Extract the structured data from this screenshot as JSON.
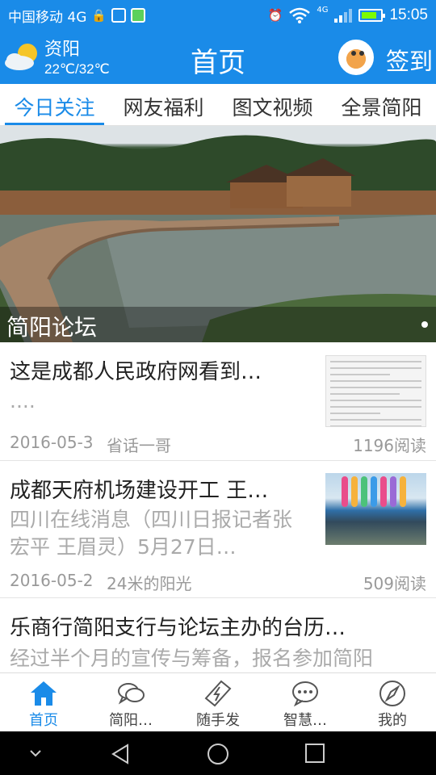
{
  "status_bar": {
    "carrier": "中国移动 4G",
    "network": "4G",
    "time": "15:05"
  },
  "header": {
    "city": "资阳",
    "temperature": "22℃/32℃",
    "title": "首页",
    "checkin_label": "签到",
    "weather_icon": "partly-cloudy-icon"
  },
  "tabs": [
    {
      "label": "今日关注",
      "active": true
    },
    {
      "label": "网友福利",
      "active": false
    },
    {
      "label": "图文视频",
      "active": false
    },
    {
      "label": "全景简阳",
      "active": false
    }
  ],
  "banner": {
    "caption": "简阳论坛"
  },
  "news": [
    {
      "title": "这是成都人民政府网看到…",
      "summary": "....",
      "date": "2016-05-3",
      "author": "省话一哥",
      "reads": "1196阅读"
    },
    {
      "title": "成都天府机场建设开工 王…",
      "summary": "四川在线消息（四川日报记者张宏平 王眉灵）5月27日…",
      "date": "2016-05-2",
      "author": "24米的阳光",
      "reads": "509阅读"
    },
    {
      "title": "乐商行简阳支行与论坛主办的台历…",
      "summary": "经过半个月的宣传与筹备，报名参加简阳"
    }
  ],
  "bottom_nav": [
    {
      "label": "首页",
      "icon": "home-icon",
      "active": true
    },
    {
      "label": "简阳…",
      "icon": "chat-bubbles-icon",
      "active": false
    },
    {
      "label": "随手发",
      "icon": "lightning-tag-icon",
      "active": false
    },
    {
      "label": "智慧…",
      "icon": "message-dots-icon",
      "active": false
    },
    {
      "label": "我的",
      "icon": "compass-icon",
      "active": false
    }
  ],
  "colors": {
    "primary": "#1a8be8",
    "text": "#222222",
    "muted": "#999999"
  }
}
